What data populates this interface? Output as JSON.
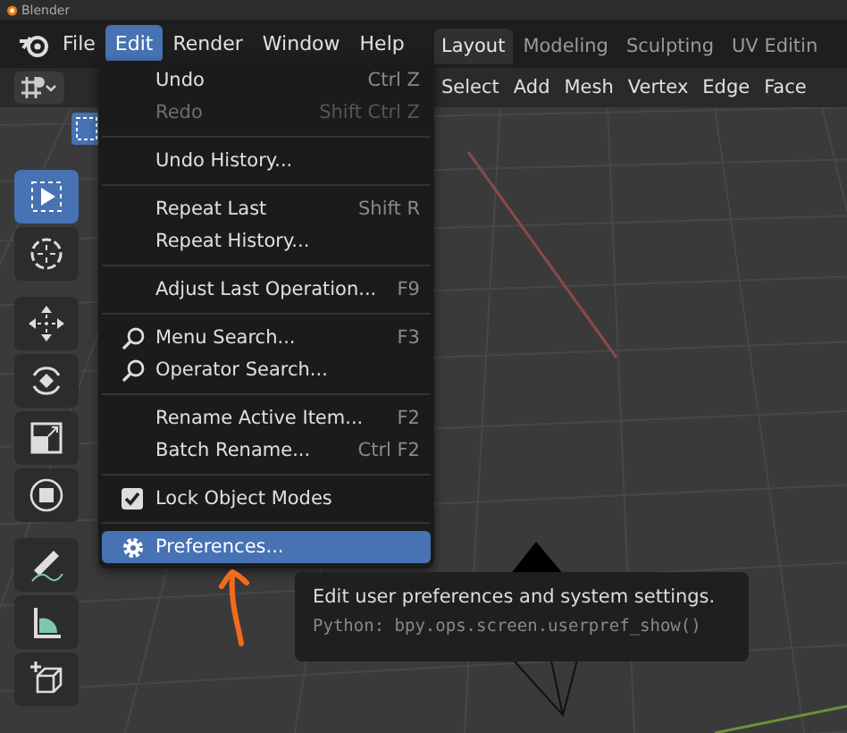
{
  "window": {
    "title": "Blender"
  },
  "menubar": [
    {
      "label": "File",
      "selected": false
    },
    {
      "label": "Edit",
      "selected": true
    },
    {
      "label": "Render",
      "selected": false
    },
    {
      "label": "Window",
      "selected": false
    },
    {
      "label": "Help",
      "selected": false
    }
  ],
  "workspace_tabs": [
    {
      "label": "Layout",
      "selected": true
    },
    {
      "label": "Modeling",
      "selected": false
    },
    {
      "label": "Sculpting",
      "selected": false
    },
    {
      "label": "UV Editin",
      "selected": false
    }
  ],
  "header_menus": [
    "Select",
    "Add",
    "Mesh",
    "Vertex",
    "Edge",
    "Face"
  ],
  "tools": [
    {
      "kind": "select",
      "selected": true
    },
    {
      "kind": "cursor",
      "selected": false
    },
    {
      "kind": "move",
      "selected": false
    },
    {
      "kind": "rotate",
      "selected": false
    },
    {
      "kind": "scale",
      "selected": false
    },
    {
      "kind": "transform",
      "selected": false
    },
    {
      "kind": "annotate",
      "selected": false
    },
    {
      "kind": "measure",
      "selected": false
    },
    {
      "kind": "add-cube",
      "selected": false
    }
  ],
  "edit_menu": [
    {
      "kind": "plain",
      "label": "Undo",
      "shortcut": "Ctrl Z",
      "disabled": false,
      "selected": false
    },
    {
      "kind": "plain",
      "label": "Redo",
      "shortcut": "Shift Ctrl Z",
      "disabled": true,
      "selected": false
    },
    {
      "kind": "separator"
    },
    {
      "kind": "plain",
      "label": "Undo History...",
      "disabled": false,
      "selected": false
    },
    {
      "kind": "separator"
    },
    {
      "kind": "plain",
      "label": "Repeat Last",
      "shortcut": "Shift R",
      "disabled": false,
      "selected": false
    },
    {
      "kind": "plain",
      "label": "Repeat History...",
      "disabled": false,
      "selected": false
    },
    {
      "kind": "separator"
    },
    {
      "kind": "plain",
      "label": "Adjust Last Operation...",
      "shortcut": "F9",
      "disabled": false,
      "selected": false
    },
    {
      "kind": "separator"
    },
    {
      "kind": "search",
      "label": "Menu Search...",
      "shortcut": "F3",
      "disabled": false,
      "selected": false
    },
    {
      "kind": "search",
      "label": "Operator Search...",
      "disabled": false,
      "selected": false
    },
    {
      "kind": "separator"
    },
    {
      "kind": "plain",
      "label": "Rename Active Item...",
      "shortcut": "F2",
      "disabled": false,
      "selected": false
    },
    {
      "kind": "plain",
      "label": "Batch Rename...",
      "shortcut": "Ctrl F2",
      "disabled": false,
      "selected": false
    },
    {
      "kind": "separator"
    },
    {
      "kind": "toggle",
      "label": "Lock Object Modes",
      "checked": true,
      "disabled": false,
      "selected": false
    },
    {
      "kind": "separator"
    },
    {
      "kind": "settings",
      "label": "Preferences...",
      "disabled": false,
      "selected": true
    }
  ],
  "tooltip": {
    "description": "Edit user preferences and system settings.",
    "python": "Python: bpy.ops.screen.userpref_show()"
  }
}
